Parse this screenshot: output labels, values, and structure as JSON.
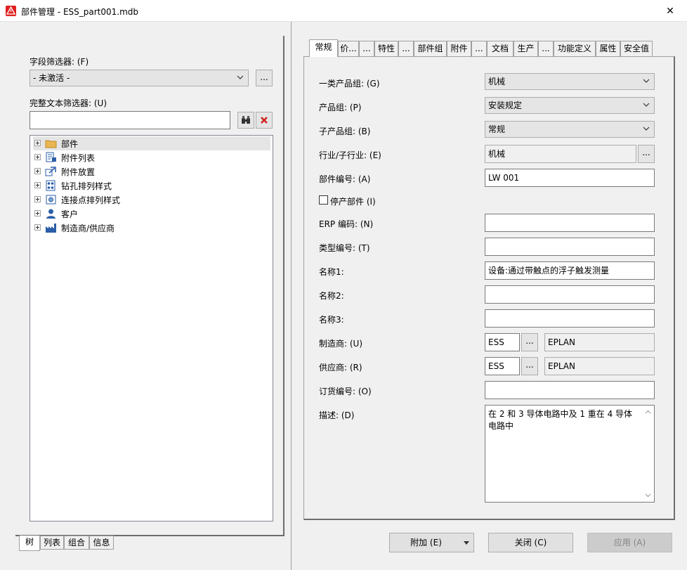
{
  "window": {
    "title": "部件管理 - ESS_part001.mdb",
    "close_glyph": "✕"
  },
  "left": {
    "field_filter_label": "字段筛选器: (F)",
    "field_filter_value": "- 未激活 -",
    "field_filter_more": "...",
    "fulltext_filter_label": "完整文本筛选器: (U)",
    "fulltext_value": "",
    "tree": [
      {
        "label": "部件",
        "icon": "folder-icon",
        "selected": true
      },
      {
        "label": "附件列表",
        "icon": "accessory-list-icon"
      },
      {
        "label": "附件放置",
        "icon": "accessory-placement-icon"
      },
      {
        "label": "钻孔排列样式",
        "icon": "drilling-pattern-icon"
      },
      {
        "label": "连接点排列样式",
        "icon": "connection-pattern-icon"
      },
      {
        "label": "客户",
        "icon": "customer-icon"
      },
      {
        "label": "制造商/供应商",
        "icon": "manufacturer-icon"
      }
    ],
    "bottom_tabs": [
      "树",
      "列表",
      "组合",
      "信息"
    ]
  },
  "tabs": [
    "常规",
    "价...",
    "...",
    "特性",
    "...",
    "部件组",
    "附件",
    "...",
    "文档",
    "生产",
    "...",
    "功能定义",
    "属性",
    "安全值"
  ],
  "form": {
    "product_group1_label": "一类产品组: (G)",
    "product_group1_value": "机械",
    "product_group_label": "产品组: (P)",
    "product_group_value": "安装规定",
    "sub_product_group_label": "子产品组: (B)",
    "sub_product_group_value": "常规",
    "industry_label": "行业/子行业: (E)",
    "industry_value": "机械",
    "part_number_label": "部件编号: (A)",
    "part_number_value": "LW 001",
    "discontinued_label": "停产部件 (I)",
    "erp_label": "ERP 编码: (N)",
    "erp_value": "",
    "type_number_label": "类型编号: (T)",
    "type_number_value": "",
    "name1_label": "名称1:",
    "name1_value": "设备:通过带触点的浮子触发测量",
    "name2_label": "名称2:",
    "name2_value": "",
    "name3_label": "名称3:",
    "name3_value": "",
    "manufacturer_label": "制造商: (U)",
    "manufacturer_code": "ESS",
    "manufacturer_name": "EPLAN",
    "supplier_label": "供应商: (R)",
    "supplier_code": "ESS",
    "supplier_name": "EPLAN",
    "order_number_label": "订货编号: (O)",
    "order_number_value": "",
    "description_label": "描述: (D)",
    "description_value": "在 2 和 3 导体电路中及 1 重在 4 导体电路中",
    "more": "..."
  },
  "buttons": {
    "add": "附加 (E)",
    "close": "关闭 (C)",
    "apply": "应用 (A)"
  }
}
